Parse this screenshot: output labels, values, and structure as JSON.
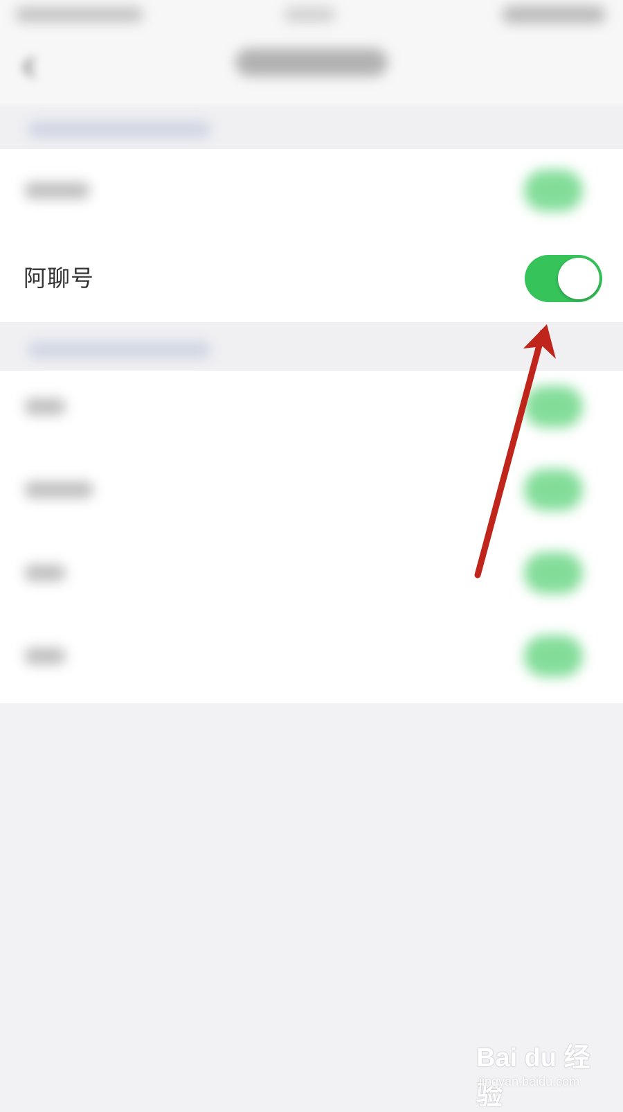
{
  "highlighted_row": {
    "label": "阿聊号",
    "toggle_on": true
  },
  "colors": {
    "toggle_on": "#35c35a",
    "arrow": "#c0251b",
    "background": "#f2f2f5"
  },
  "watermark": {
    "logo_text": "Bai du 经验",
    "url": "jingyan.baidu.com"
  },
  "icons": {
    "back": "chevron-left-icon",
    "annotation": "red-arrow"
  }
}
